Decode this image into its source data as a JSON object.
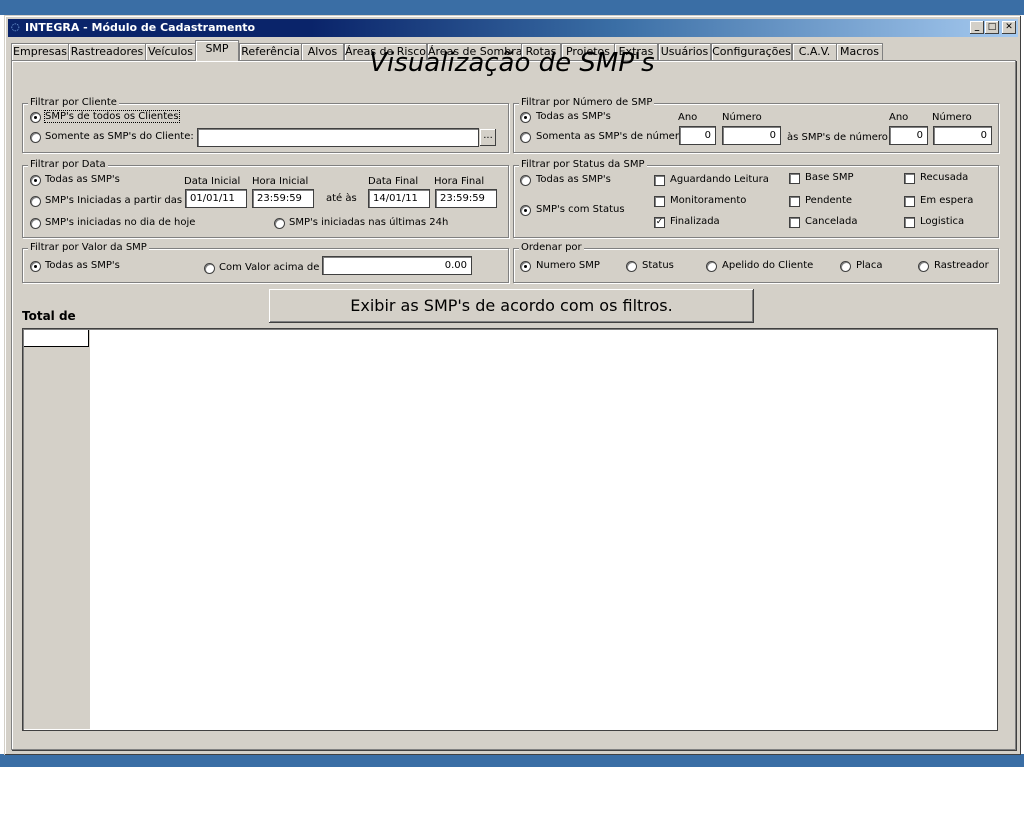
{
  "window": {
    "title": "INTEGRA - Módulo de Cadastramento"
  },
  "tabs": [
    "Empresas",
    "Rastreadores",
    "Veículos",
    "SMP",
    "Referência",
    "Alvos",
    "Áreas de Risco",
    "Áreas de Sombra",
    "Rotas",
    "Projetos",
    "Extras",
    "Usuários",
    "Configurações",
    "C.A.V.",
    "Macros"
  ],
  "active_tab": "SMP",
  "page_title": "Visualização de SMP's",
  "filtro_cliente": {
    "title": "Filtrar por Cliente",
    "opt_todos": "SMP's de todos os Clientes",
    "opt_cliente": "Somente as SMP's do Cliente:",
    "cliente_value": "",
    "browse": "..."
  },
  "filtro_numero": {
    "title": "Filtrar por Número de SMP",
    "opt_todas": "Todas as SMP's",
    "opt_numero": "Somenta as SMP's de número",
    "ano_label": "Ano",
    "numero_label": "Número",
    "ano_de": "0",
    "numero_de": "0",
    "ate_label": "às SMP's de número:",
    "ano_ate": "0",
    "numero_ate": "0"
  },
  "filtro_data": {
    "title": "Filtrar por Data",
    "opt_todas": "Todas as SMP's",
    "opt_partir": "SMP's Iniciadas a partir das",
    "opt_hoje": "SMP's iniciadas no dia de hoje",
    "opt_24h": "SMP's iniciadas nas últimas 24h",
    "data_inicial_label": "Data Inicial",
    "hora_inicial_label": "Hora Inicial",
    "data_final_label": "Data Final",
    "hora_final_label": "Hora Final",
    "data_inicial": "01/01/11",
    "hora_inicial": "23:59:59",
    "ate_as": "até às",
    "data_final": "14/01/11",
    "hora_final": "23:59:59"
  },
  "filtro_status": {
    "title": "Filtrar por Status da SMP",
    "opt_todas": "Todas as SMP's",
    "opt_status": "SMP's com Status",
    "checks": [
      {
        "label": "Aguardando Leitura",
        "checked": false
      },
      {
        "label": "Monitoramento",
        "checked": false
      },
      {
        "label": "Finalizada",
        "checked": true
      },
      {
        "label": "Base SMP",
        "checked": false
      },
      {
        "label": "Pendente",
        "checked": false
      },
      {
        "label": "Cancelada",
        "checked": false
      },
      {
        "label": "Recusada",
        "checked": false
      },
      {
        "label": "Em espera",
        "checked": false
      },
      {
        "label": "Logistica",
        "checked": false
      }
    ]
  },
  "filtro_valor": {
    "title": "Filtrar por Valor da SMP",
    "opt_todas": "Todas as SMP's",
    "opt_acima": "Com Valor acima de",
    "valor": "0.00"
  },
  "ordenar": {
    "title": "Ordenar por",
    "options": [
      "Numero SMP",
      "Status",
      "Apelido do Cliente",
      "Placa",
      "Rastreador"
    ],
    "selected": "Numero SMP"
  },
  "exibir_button": "Exibir as SMP's de acordo com os filtros.",
  "total_label": "Total de"
}
